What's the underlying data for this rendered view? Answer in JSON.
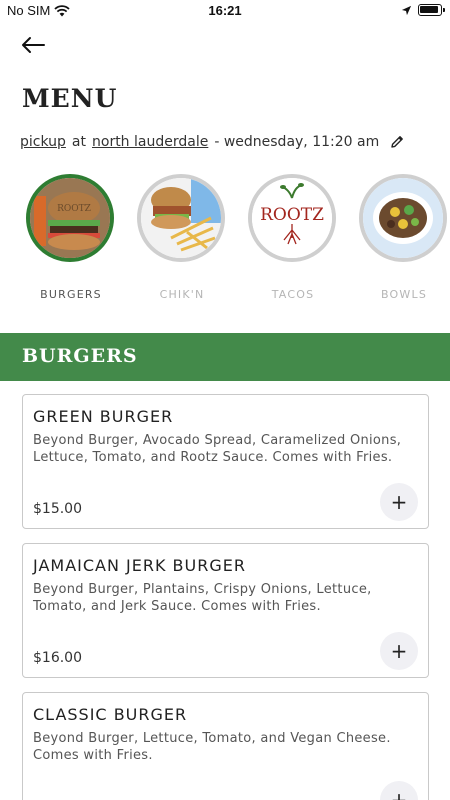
{
  "status_bar": {
    "carrier": "No SIM",
    "time": "16:21"
  },
  "page": {
    "title": "MENU"
  },
  "order_info": {
    "mode": "pickup",
    "connector": "at",
    "location": "north lauderdale",
    "datetime": "- wednesday, 11:20 am"
  },
  "categories": [
    {
      "label": "BURGERS",
      "active": true
    },
    {
      "label": "CHIK'N",
      "active": false
    },
    {
      "label": "TACOS",
      "active": false,
      "logo_text": "ROOTZ"
    },
    {
      "label": "BOWLS",
      "active": false
    }
  ],
  "section": {
    "title": "BURGERS"
  },
  "items": [
    {
      "name": "GREEN BURGER",
      "description": "Beyond Burger, Avocado Spread, Caramelized Onions, Lettuce, Tomato, and Rootz Sauce. Comes with Fries.",
      "price": "$15.00"
    },
    {
      "name": "JAMAICAN JERK BURGER",
      "description": "Beyond Burger, Plantains, Crispy Onions, Lettuce, Tomato, and Jerk Sauce. Comes with Fries.",
      "price": "$16.00"
    },
    {
      "name": "CLASSIC BURGER",
      "description": "Beyond Burger, Lettuce, Tomato, and Vegan Cheese. Comes with Fries.",
      "price": ""
    }
  ],
  "add_label": "+",
  "colors": {
    "accent_green": "#438a4a",
    "active_ring": "#2e7d32"
  },
  "icons": [
    "back-arrow-icon",
    "edit-pencil-icon",
    "wifi-icon",
    "location-arrow-icon",
    "battery-icon",
    "plus-icon"
  ]
}
